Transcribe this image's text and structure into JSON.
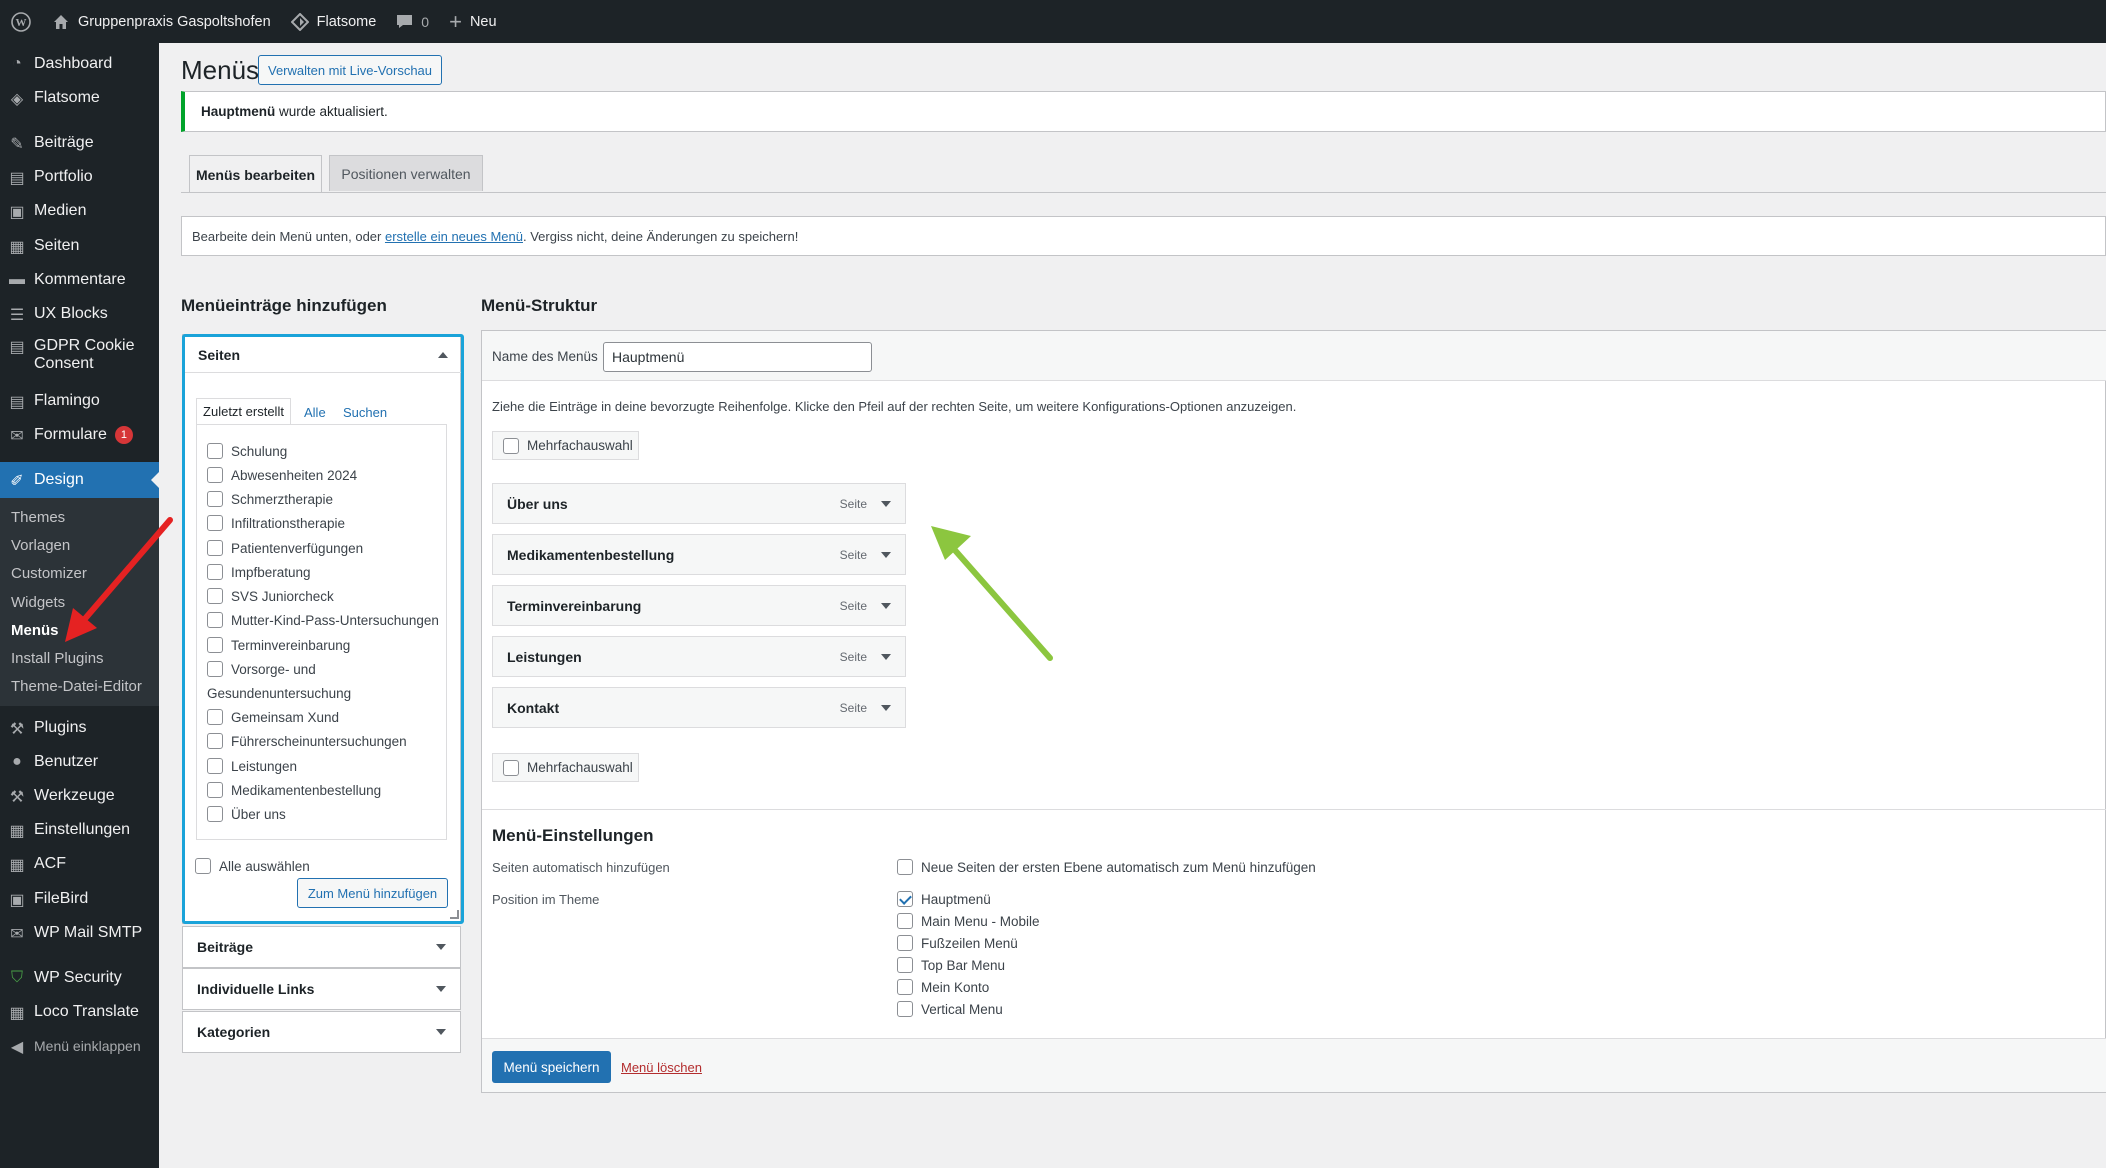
{
  "adminbar": {
    "site_name": "Gruppenpraxis Gaspoltshofen",
    "theme": "Flatsome",
    "comments_count": "0",
    "new_label": "Neu"
  },
  "sidebar": {
    "items": [
      {
        "label": "Dashboard",
        "icon": "dashboard-icon"
      },
      {
        "label": "Flatsome",
        "icon": "flatsome-icon"
      },
      {
        "label": "Beiträge",
        "icon": "pin-icon"
      },
      {
        "label": "Portfolio",
        "icon": "portfolio-icon"
      },
      {
        "label": "Medien",
        "icon": "media-icon"
      },
      {
        "label": "Seiten",
        "icon": "page-icon"
      },
      {
        "label": "Kommentare",
        "icon": "comment-icon"
      },
      {
        "label": "UX Blocks",
        "icon": "blocks-icon"
      },
      {
        "label": "GDPR Cookie Consent",
        "icon": "cookie-icon"
      },
      {
        "label": "Flamingo",
        "icon": "flamingo-icon"
      },
      {
        "label": "Formulare",
        "icon": "mail-icon",
        "badge": "1"
      },
      {
        "label": "Design",
        "icon": "brush-icon"
      },
      {
        "label": "Plugins",
        "icon": "plugin-icon"
      },
      {
        "label": "Benutzer",
        "icon": "user-icon"
      },
      {
        "label": "Werkzeuge",
        "icon": "wrench-icon"
      },
      {
        "label": "Einstellungen",
        "icon": "settings-icon"
      },
      {
        "label": "ACF",
        "icon": "acf-icon"
      },
      {
        "label": "FileBird",
        "icon": "folder-icon"
      },
      {
        "label": "WP Mail SMTP",
        "icon": "mail-smtp-icon"
      },
      {
        "label": "WP Security",
        "icon": "shield-icon"
      },
      {
        "label": "Loco Translate",
        "icon": "translate-icon"
      },
      {
        "label": "Menü einklappen",
        "icon": "collapse-icon"
      }
    ],
    "submenu": [
      "Themes",
      "Vorlagen",
      "Customizer",
      "Widgets",
      "Menüs",
      "Install Plugins",
      "Theme-Datei-Editor"
    ]
  },
  "header": {
    "title": "Menüs",
    "live_preview": "Verwalten mit Live-Vorschau"
  },
  "notice": {
    "bold": "Hauptmenü",
    "text": " wurde aktualisiert."
  },
  "tabs": [
    "Menüs bearbeiten",
    "Positionen verwalten"
  ],
  "info": {
    "before": "Bearbeite dein Menü unten, oder ",
    "link": "erstelle ein neues Menü",
    "after": ". Vergiss nicht, deine Änderungen zu speichern!"
  },
  "add_items": {
    "heading": "Menüeinträge hinzufügen",
    "pages_title": "Seiten",
    "subtabs": [
      "Zuletzt erstellt",
      "Alle",
      "Suchen"
    ],
    "pages": [
      "Schulung",
      "Abwesenheiten 2024",
      "Schmerztherapie",
      "Infiltrationstherapie",
      "Patientenverfügungen",
      "Impfberatung",
      "SVS Juniorcheck",
      "Mutter-Kind-Pass-Untersuchungen",
      "Terminvereinbarung",
      "Vorsorge- und",
      "Gemeinsam Xund",
      "Führerscheinuntersuchungen",
      "Leistungen",
      "Medikamentenbestellung",
      "Über uns"
    ],
    "wrap_continuation": "Gesundenuntersuchung",
    "select_all": "Alle auswählen",
    "add_button": "Zum Menü hinzufügen",
    "other_sections": [
      "Beiträge",
      "Individuelle Links",
      "Kategorien"
    ]
  },
  "structure": {
    "heading": "Menü-Struktur",
    "name_label": "Name des Menüs",
    "name_value": "Hauptmenü",
    "instructions": "Ziehe die Einträge in deine bevorzugte Reihenfolge. Klicke den Pfeil auf der rechten Seite, um weitere Konfigurations-Optionen anzuzeigen.",
    "multi_select": "Mehrfachauswahl",
    "entries": [
      {
        "title": "Über uns",
        "type": "Seite"
      },
      {
        "title": "Medikamentenbestellung",
        "type": "Seite"
      },
      {
        "title": "Terminvereinbarung",
        "type": "Seite"
      },
      {
        "title": "Leistungen",
        "type": "Seite"
      },
      {
        "title": "Kontakt",
        "type": "Seite"
      }
    ]
  },
  "settings": {
    "heading": "Menü-Einstellungen",
    "auto_add_label": "Seiten automatisch hinzufügen",
    "auto_add_option": "Neue Seiten der ersten Ebene automatisch zum Menü hinzufügen",
    "position_label": "Position im Theme",
    "positions": [
      {
        "label": "Hauptmenü",
        "checked": true
      },
      {
        "label": "Main Menu - Mobile",
        "checked": false
      },
      {
        "label": "Fußzeilen Menü",
        "checked": false
      },
      {
        "label": "Top Bar Menu",
        "checked": false
      },
      {
        "label": "Mein Konto",
        "checked": false
      },
      {
        "label": "Vertical Menu",
        "checked": false
      }
    ],
    "save": "Menü speichern",
    "delete": "Menü löschen"
  },
  "colors": {
    "accent": "#2271b1",
    "highlight_box": "#1aa3d9",
    "red_arrow": "#e52222",
    "green_arrow": "#8cc63f"
  }
}
